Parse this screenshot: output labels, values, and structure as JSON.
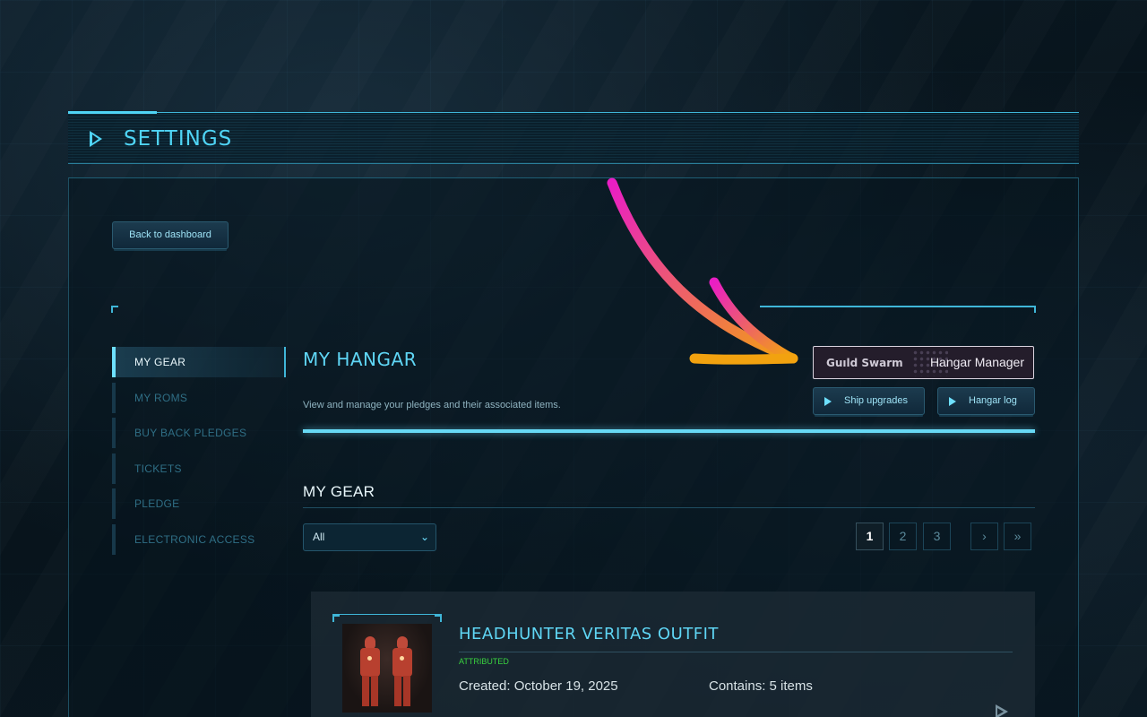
{
  "header": {
    "title": "SETTINGS"
  },
  "back_button": {
    "label": "Back to dashboard"
  },
  "sidebar": {
    "items": [
      {
        "label": "MY GEAR",
        "active": true
      },
      {
        "label": "MY ROMS",
        "active": false
      },
      {
        "label": "BUY BACK PLEDGES",
        "active": false
      },
      {
        "label": "TICKETS",
        "active": false
      },
      {
        "label": "PLEDGE",
        "active": false
      },
      {
        "label": "ELECTRONIC ACCESS",
        "active": false
      }
    ]
  },
  "hangar": {
    "title": "MY HANGAR",
    "description": "View and manage your pledges and their associated items.",
    "hangar_manager": {
      "logo": "Guıld Swarm",
      "label": "Hangar Manager"
    },
    "ship_upgrades_label": "Ship upgrades",
    "hangar_log_label": "Hangar log"
  },
  "gear": {
    "title": "MY GEAR",
    "filter": {
      "selected": "All"
    },
    "pagination": {
      "pages": [
        "1",
        "2",
        "3"
      ],
      "current": "1",
      "next": "›",
      "last": "»"
    }
  },
  "items": [
    {
      "title": "HEADHUNTER VERITAS OUTFIT",
      "status": "ATTRIBUTED",
      "created": "Created: October 19, 2025",
      "contains": "Contains: 5 items"
    }
  ],
  "colors": {
    "accent": "#4fd4f5",
    "status_green": "#39d33f",
    "annotation_gradient_start": "#e91ec4",
    "annotation_gradient_end": "#f2a20f"
  }
}
